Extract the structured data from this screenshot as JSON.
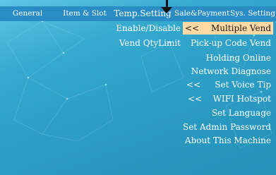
{
  "tabs": [
    {
      "label": "General",
      "active": false
    },
    {
      "label": "Item & Slot",
      "active": false
    },
    {
      "label": "Temp.Setting",
      "active": true
    },
    {
      "label": "Sale&Payment",
      "active": false
    },
    {
      "label": "Sys. Setting",
      "active": false
    }
  ],
  "left_column": [
    "Enable/Disable",
    "Vend QtyLimit"
  ],
  "right_column": [
    "Multiple Vend",
    "Pick-up Code Vend",
    "Holding Online",
    "Network Diagnose",
    "Set Voice Tip",
    "WIFI Hotspot",
    "Set Language",
    "Set Admin Password",
    "About This Machine"
  ],
  "arrows": [
    "<<",
    "<<",
    "<<"
  ],
  "colors": {
    "background": "#2b9cc4",
    "tabbar": "#2a8cc5",
    "highlight": "#ffd9a3",
    "text": "#ffffff"
  }
}
